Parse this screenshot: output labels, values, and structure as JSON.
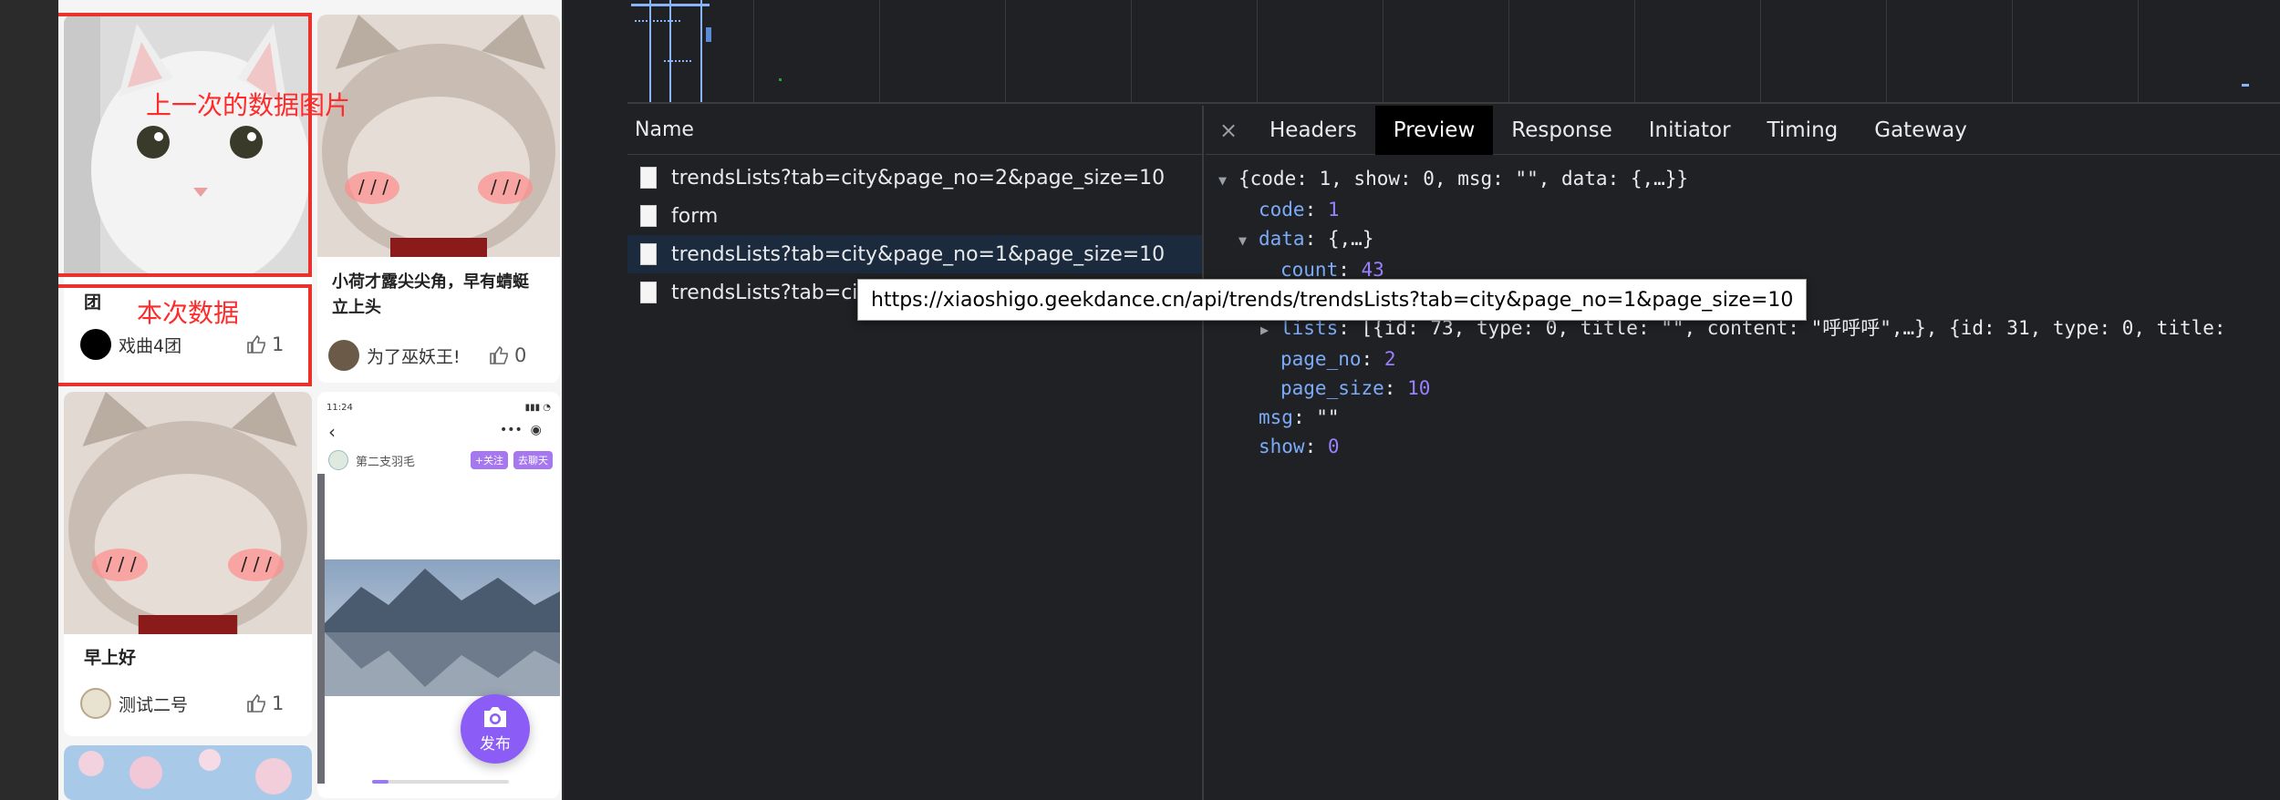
{
  "feed": {
    "annotation_prev": "上一次的数据图片",
    "annotation_current": "本次数据",
    "cards": [
      {
        "title": "团",
        "user": "戏曲4团",
        "likes": "1"
      },
      {
        "title": "小荷才露尖尖角，早有蜻蜓立上头",
        "user": "为了巫妖王!",
        "likes": "0"
      },
      {
        "title": "早上好",
        "user": "测试二号",
        "likes": "1"
      }
    ],
    "embedded_screenshot": {
      "time": "11:24",
      "user": "第二支羽毛",
      "follow": "+关注",
      "chat": "去聊天"
    },
    "publish_label": "发布"
  },
  "devtools": {
    "name_header": "Name",
    "requests": [
      "trendsLists?tab=city&page_no=2&page_size=10",
      "form",
      "trendsLists?tab=city&page_no=1&page_size=10",
      "trendsLists?tab=city"
    ],
    "tooltip": "https://xiaoshigo.geekdance.cn/api/trends/trendsLists?tab=city&page_no=1&page_size=10",
    "tabs": [
      "Headers",
      "Preview",
      "Response",
      "Initiator",
      "Timing",
      "Gateway"
    ],
    "active_tab": "Preview",
    "close_glyph": "×",
    "json": {
      "root": "{code: 1, show: 0, msg: \"\", data: {,…}}",
      "code_key": "code",
      "code_val": "1",
      "data_key": "data",
      "data_val": "{,…}",
      "count_key": "count",
      "count_val": "43",
      "lists_key": "lists",
      "lists_val": "[{id: 73, type: 0, title: \"\", content: \"呼呼呼\",…}, {id: 31, type: 0, title:",
      "page_no_key": "page_no",
      "page_no_val": "2",
      "page_size_key": "page_size",
      "page_size_val": "10",
      "msg_key": "msg",
      "msg_val": "\"\"",
      "show_key": "show",
      "show_val": "0"
    }
  },
  "colors": {
    "accent_purple": "#8b5cf6",
    "annotation_red": "#e8322b"
  }
}
